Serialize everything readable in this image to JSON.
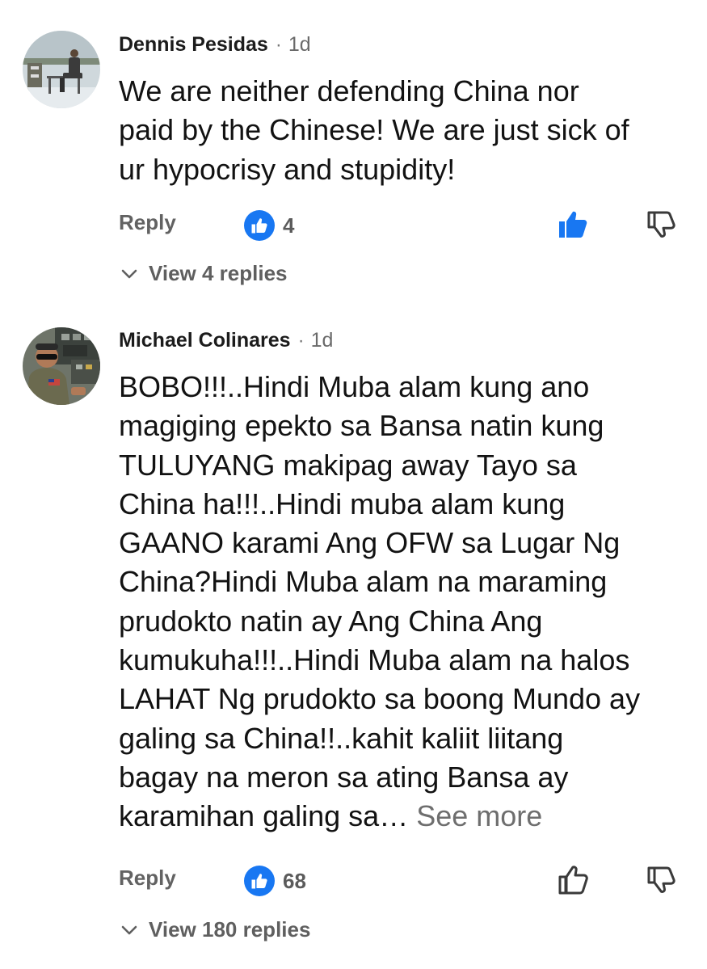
{
  "comments": [
    {
      "author": "Dennis Pesidas",
      "separator": "·",
      "time": "1d",
      "text": "We  are neither  defending China nor\npaid by the Chinese! We are just sick of\nur hypocrisy and stupidity!",
      "see_more": "",
      "reply_label": "Reply",
      "like_count": "4",
      "liked_by_viewer": true,
      "view_replies_label": "View 4 replies",
      "avatar_icon": "avatar-person-snow-photo"
    },
    {
      "author": "Michael Colinares",
      "separator": "·",
      "time": "1d",
      "text": "BOBO!!!..Hindi Muba alam kung ano\nmagiging epekto sa Bansa natin kung\nTULUYANG makipag away Tayo sa\nChina ha!!!..Hindi muba alam kung\nGAANO karami Ang OFW sa Lugar Ng\nChina?Hindi Muba alam na maraming\nprudokto natin ay Ang China Ang\nkumukuha!!!..Hindi Muba alam na halos\nLAHAT Ng prudokto sa boong Mundo ay\ngaling sa China!!..kahit kaliit liitang\nbagay na meron sa ating Bansa  ay\nkaramihan galing sa… ",
      "see_more": "See more",
      "reply_label": "Reply",
      "like_count": "68",
      "liked_by_viewer": false,
      "view_replies_label": "View 180 replies",
      "avatar_icon": "avatar-pilot-cockpit-photo"
    }
  ],
  "colors": {
    "like_blue": "#1877f2",
    "text": "#121212",
    "muted": "#626262"
  }
}
